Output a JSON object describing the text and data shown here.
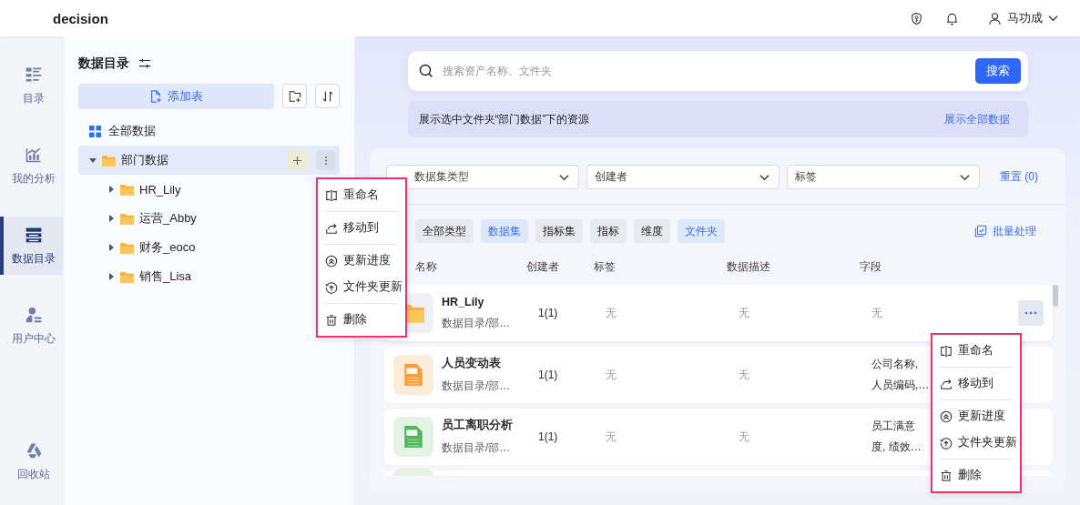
{
  "app": {
    "title": "decision"
  },
  "header": {
    "user": "马功成"
  },
  "rail": [
    {
      "label": "目录",
      "kind": "catalog",
      "selected": false
    },
    {
      "label": "我的分析",
      "kind": "analysis",
      "selected": false
    },
    {
      "label": "数据目录",
      "kind": "data",
      "selected": true
    },
    {
      "label": "用户中心",
      "kind": "user",
      "selected": false
    }
  ],
  "recycle": {
    "label": "回收站"
  },
  "tree_panel": {
    "title": "数据目录",
    "add_button": "添加表",
    "root": "全部数据",
    "folders": [
      {
        "label": "部门数据",
        "expanded": true,
        "selected": true,
        "children": [
          {
            "label": "HR_Lily",
            "expanded": false,
            "selected": false
          },
          {
            "label": "运营_Abby",
            "expanded": false,
            "selected": false
          },
          {
            "label": "财务_eoco",
            "expanded": false,
            "selected": false
          },
          {
            "label": "销售_Lisa",
            "expanded": false,
            "selected": false
          }
        ]
      }
    ]
  },
  "tree_menu": {
    "groups": [
      {
        "items": [
          {
            "label": "重命名",
            "kind": "rename"
          }
        ]
      },
      {
        "items": [
          {
            "label": "移动到",
            "kind": "move"
          }
        ]
      },
      {
        "items": [
          {
            "label": "更新进度",
            "kind": "progress"
          },
          {
            "label": "文件夹更新",
            "kind": "update"
          }
        ]
      },
      {
        "items": [
          {
            "label": "删除",
            "kind": "delete"
          }
        ]
      }
    ]
  },
  "search": {
    "placeholder": "搜索资产名称、文件夹",
    "button": "搜索"
  },
  "notice": {
    "text": "展示选中文件夹“部门数据”下的资源",
    "link": "展示全部数据"
  },
  "filters": [
    {
      "placeholder": "数据集类型"
    },
    {
      "placeholder": "创建者"
    },
    {
      "placeholder": "标签"
    }
  ],
  "reset": "重置 (0)",
  "chips": [
    {
      "label": "全部类型",
      "selected": false
    },
    {
      "label": "数据集",
      "selected": true
    },
    {
      "label": "指标集",
      "selected": false
    },
    {
      "label": "指标",
      "selected": false
    },
    {
      "label": "维度",
      "selected": false
    },
    {
      "label": "文件夹",
      "selected": true
    }
  ],
  "batch": "批量处理",
  "columns": [
    "名称",
    "创建者",
    "标签",
    "数据描述",
    "字段"
  ],
  "rows": [
    {
      "kind": "folder",
      "name": "HR_Lily",
      "path": "数据目录/部…",
      "creator": "1(1)",
      "tag": "无",
      "description": "无",
      "fields": [
        "无"
      ],
      "hovered": true
    },
    {
      "kind": "sql",
      "name": "人员变动表",
      "path": "数据目录/部…",
      "creator": "1(1)",
      "tag": "无",
      "description": "无",
      "fields": [
        "公司名称,",
        "人员编码,…"
      ],
      "hovered": false
    },
    {
      "kind": "xls",
      "name": "员工离职分析",
      "path": "数据目录/部…",
      "creator": "1(1)",
      "tag": "无",
      "description": "无",
      "fields": [
        "员工满意",
        "度, 绩效…"
      ],
      "hovered": false
    }
  ],
  "row_menu": {
    "groups": [
      {
        "items": [
          {
            "label": "重命名",
            "kind": "rename"
          }
        ]
      },
      {
        "items": [
          {
            "label": "移动到",
            "kind": "move"
          }
        ]
      },
      {
        "items": [
          {
            "label": "更新进度",
            "kind": "progress"
          },
          {
            "label": "文件夹更新",
            "kind": "update"
          }
        ]
      },
      {
        "items": [
          {
            "label": "删除",
            "kind": "delete"
          }
        ]
      }
    ]
  }
}
